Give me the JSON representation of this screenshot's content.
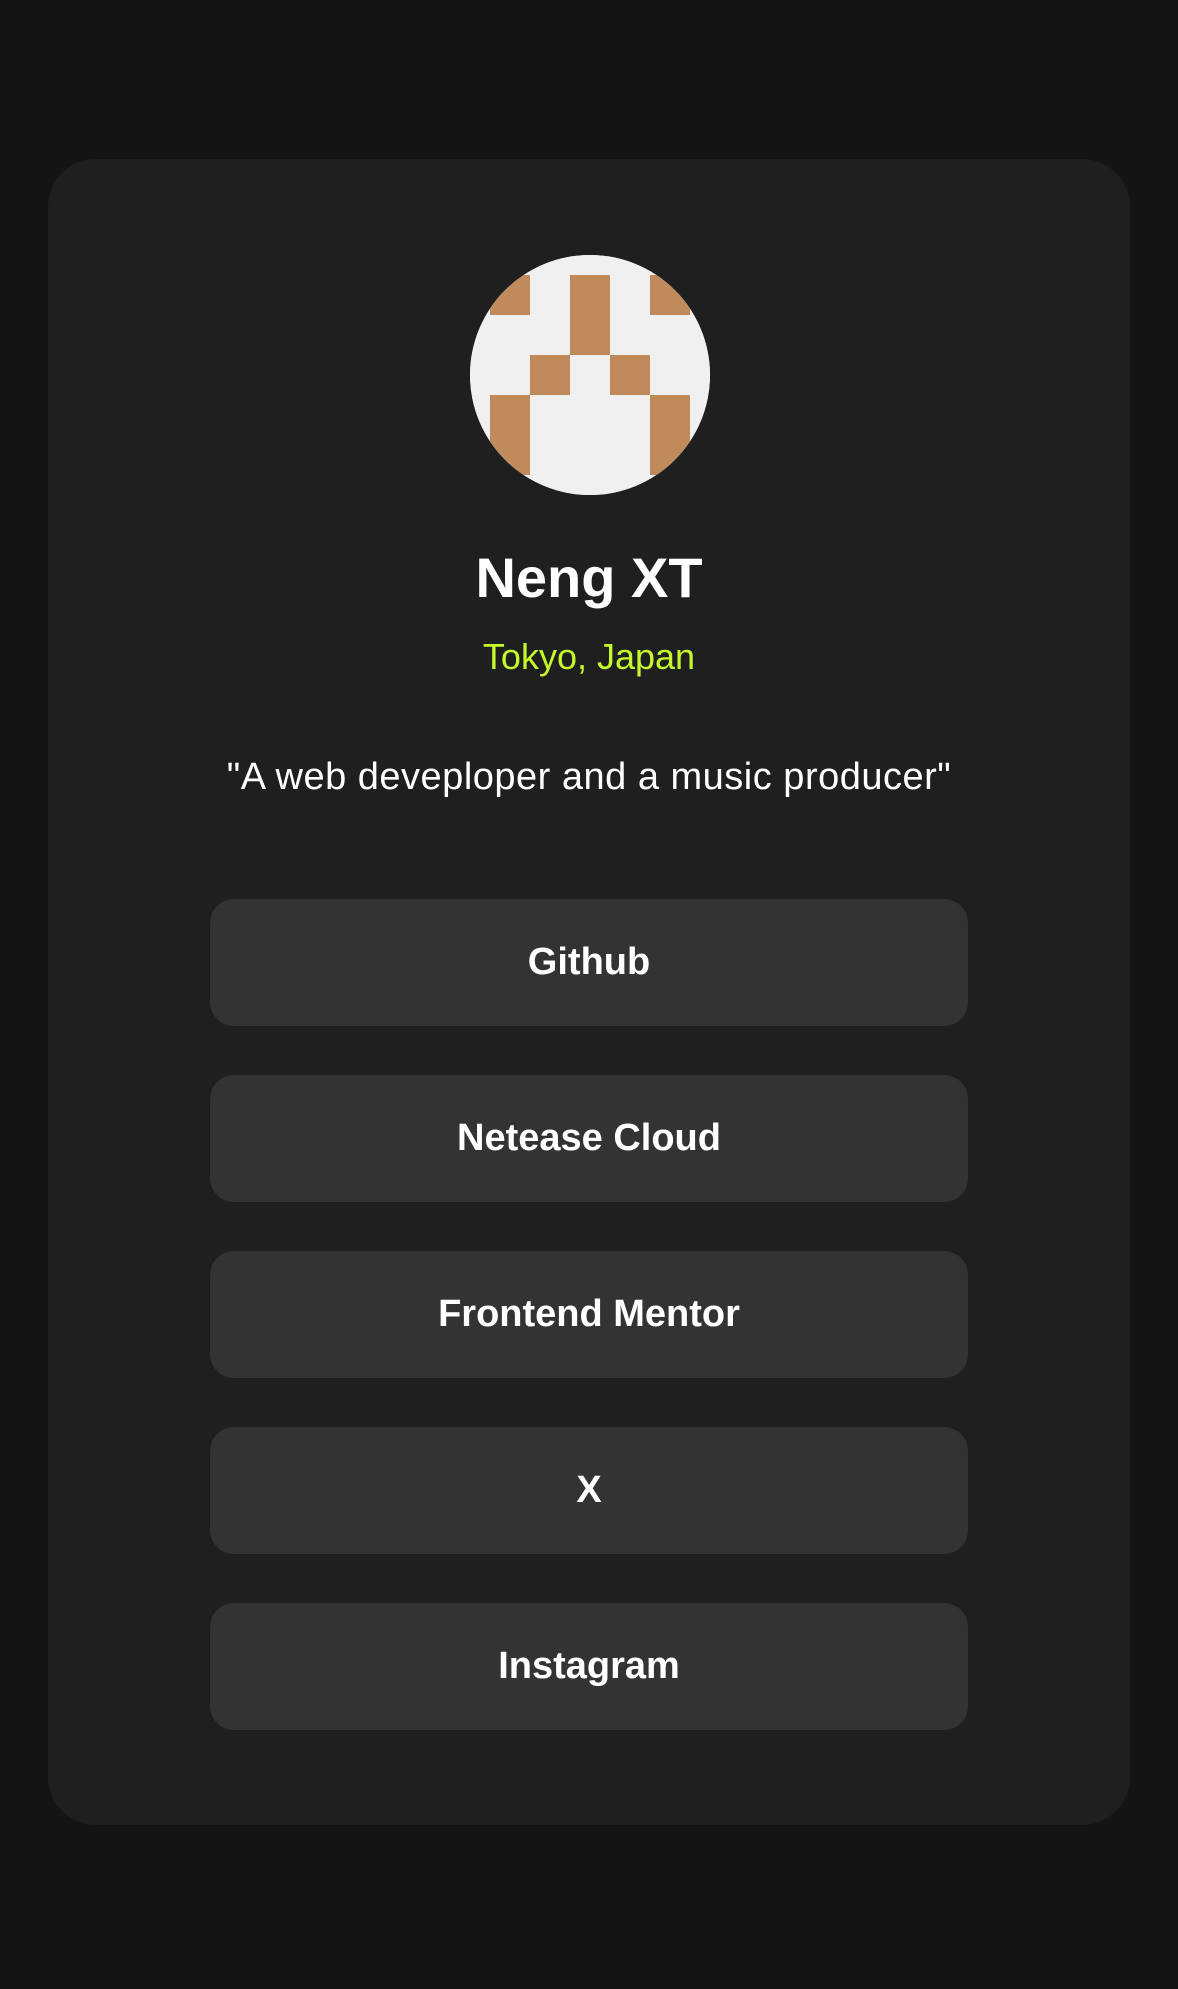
{
  "profile": {
    "name": "Neng XT",
    "location": "Tokyo, Japan",
    "bio": "\"A web deveploper and a music producer\""
  },
  "links": [
    {
      "label": "Github"
    },
    {
      "label": "Netease Cloud"
    },
    {
      "label": "Frontend Mentor"
    },
    {
      "label": "X"
    },
    {
      "label": "Instagram"
    }
  ],
  "colors": {
    "page_background": "#141414",
    "card_background": "#1f1f1f",
    "button_background": "#333333",
    "accent": "#c4f82a",
    "avatar_pattern": "#c08a5b",
    "avatar_background": "#f0f0f0"
  }
}
